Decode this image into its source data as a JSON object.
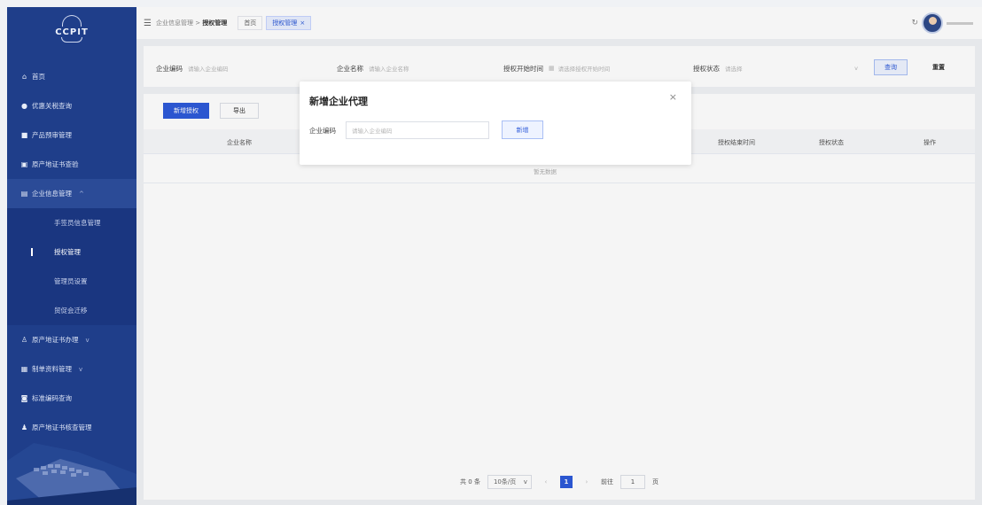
{
  "sidebar": {
    "logo_text": "CCPIT",
    "items": [
      {
        "label": "首页",
        "icon": "home-icon"
      },
      {
        "label": "优惠关税查询",
        "icon": "search-icon"
      },
      {
        "label": "产品预审管理",
        "icon": "briefcase-icon"
      },
      {
        "label": "原产地证书查验",
        "icon": "certificate-icon"
      },
      {
        "label": "企业信息管理",
        "icon": "building-icon",
        "expanded": true
      },
      {
        "label": "原产地证书办理",
        "icon": "user-badge-icon"
      },
      {
        "label": "制单资料管理",
        "icon": "folder-icon"
      },
      {
        "label": "标准编码查询",
        "icon": "code-icon"
      },
      {
        "label": "原产地证书核查管理",
        "icon": "inspector-icon"
      }
    ],
    "submenu": [
      {
        "label": "手签员信息管理"
      },
      {
        "label": "授权管理",
        "current": true
      },
      {
        "label": "管理员设置"
      },
      {
        "label": "贸促会迁移"
      }
    ]
  },
  "topbar": {
    "breadcrumb_parent": "企业信息管理",
    "breadcrumb_sep": ">",
    "breadcrumb_current": "授权管理",
    "tabs": [
      {
        "label": "首页",
        "active": false
      },
      {
        "label": "授权管理",
        "active": true,
        "closable": true
      }
    ]
  },
  "search": {
    "company_code_label": "企业编码",
    "company_code_placeholder": "请输入企业编码",
    "company_name_label": "企业名称",
    "company_name_placeholder": "请输入企业名称",
    "start_time_label": "授权开始时间",
    "start_time_placeholder": "请选择授权开始时间",
    "status_label": "授权状态",
    "status_placeholder": "请选择",
    "query_button": "查询",
    "reset_button": "重置"
  },
  "toolbar": {
    "add_button": "新增授权",
    "export_button": "导出"
  },
  "table": {
    "columns": [
      "企业名称",
      "授权结束时间",
      "授权状态",
      "操作"
    ],
    "empty_text": "暂无数据"
  },
  "pagination": {
    "total_text": "共 0 条",
    "page_size": "10条/页",
    "current_page": "1",
    "goto_label": "前往",
    "goto_value": "1",
    "page_unit": "页"
  },
  "dialog": {
    "title": "新增企业代理",
    "field_label": "企业编码",
    "field_placeholder": "请输入企业编码",
    "submit_button": "新增"
  },
  "colors": {
    "sidebar_bg": "#1f3e8a",
    "primary": "#2d5ad9"
  }
}
